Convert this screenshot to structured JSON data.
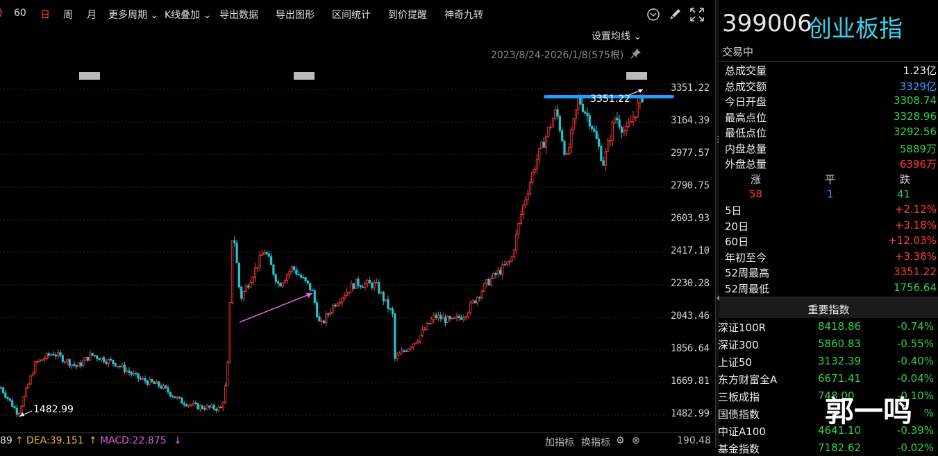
{
  "toolbar": {
    "items": [
      "60",
      "日",
      "周",
      "月",
      "更多周期 ⌄",
      "K线叠加 ⌄",
      "导出数据",
      "导出图形",
      "区间统计",
      "到价提醒",
      "神奇九转"
    ],
    "icons": [
      "chevron-down-circle-icon",
      "brush-icon",
      "expand-icon"
    ]
  },
  "chart": {
    "ma_setting": "设置均线 ⌄",
    "range": "2023/8/24-2026/1/8(575根)",
    "y_labels": [
      "3351.22",
      "3164.39",
      "2977.57",
      "2790.75",
      "2603.93",
      "2417.10",
      "2230.28",
      "2043.46",
      "1856.64",
      "1669.81",
      "1482.99"
    ],
    "low_label": "1482.99",
    "high_label": "3351.22"
  },
  "chart_data": {
    "type": "candlestick",
    "y_axis_range": [
      1482.99,
      3351.22
    ],
    "y_ticks": [
      3351.22,
      3164.39,
      2977.57,
      2790.75,
      2603.93,
      2417.1,
      2230.28,
      2043.46,
      1856.64,
      1669.81,
      1482.99
    ],
    "annotations": [
      "1482.99",
      "3351.22"
    ],
    "colors": {
      "up": "#ff3c3c",
      "down": "#23c2cf",
      "resistance": "#1aa0ff",
      "trend": "#e060e0"
    }
  },
  "indicators": {
    "left_val": "89",
    "dea": "DEA:39.151",
    "macd": "MACD:22.875",
    "add": "加指标",
    "switch": "换指标",
    "right_val": "190.48"
  },
  "quote": {
    "code": "399006",
    "name": "创业板指",
    "status": "交易中",
    "stats": [
      {
        "label": "总成交量",
        "value": "1.23亿",
        "color": "white"
      },
      {
        "label": "总成交额",
        "value": "3329亿",
        "color": "cyan"
      },
      {
        "label": "今日开盘",
        "value": "3308.74",
        "color": "green"
      },
      {
        "label": "最高点位",
        "value": "3328.96",
        "color": "green"
      },
      {
        "label": "最低点位",
        "value": "3292.56",
        "color": "green"
      },
      {
        "label": "内盘总量",
        "value": "5889万",
        "color": "green"
      },
      {
        "label": "外盘总量",
        "value": "6396万",
        "color": "red"
      }
    ],
    "breadth": {
      "up_label": "涨",
      "flat_label": "平",
      "down_label": "跌",
      "up": "58",
      "flat": "1",
      "down": "41"
    },
    "periods": [
      {
        "label": "5日",
        "value": "+2.12%",
        "color": "red"
      },
      {
        "label": "20日",
        "value": "+3.18%",
        "color": "red"
      },
      {
        "label": "60日",
        "value": "+12.03%",
        "color": "red"
      },
      {
        "label": "年初至今",
        "value": "+3.38%",
        "color": "red"
      },
      {
        "label": "52周最高",
        "value": "3351.22",
        "color": "red"
      },
      {
        "label": "52周最低",
        "value": "1756.64",
        "color": "green"
      }
    ]
  },
  "indices": {
    "title": "重要指数",
    "rows": [
      {
        "name": "深证100R",
        "value": "8418.86",
        "pct": "-0.74%"
      },
      {
        "name": "深证300",
        "value": "5860.83",
        "pct": "-0.55%"
      },
      {
        "name": "上证50",
        "value": "3132.39",
        "pct": "-0.40%"
      },
      {
        "name": "东方财富全A",
        "value": "6671.41",
        "pct": "-0.04%"
      },
      {
        "name": "三板成指",
        "value": "748.00",
        "pct": "-0.10%"
      },
      {
        "name": "国债指数",
        "value": "",
        "pct": "%"
      },
      {
        "name": "中证A100",
        "value": "4641.10",
        "pct": "-0.39%"
      },
      {
        "name": "基金指数",
        "value": "7182.62",
        "pct": "-0.02%"
      }
    ]
  },
  "watermark": "郭一鸣"
}
